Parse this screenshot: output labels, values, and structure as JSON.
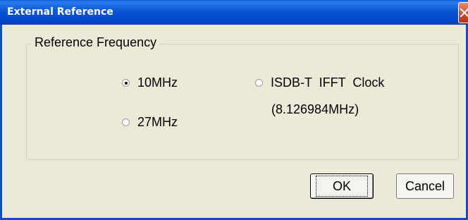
{
  "window": {
    "title": "External Reference"
  },
  "groupbox": {
    "label": "Reference Frequency"
  },
  "options": [
    {
      "label": "10MHz",
      "checked": true
    },
    {
      "label": "27MHz",
      "checked": false
    },
    {
      "label": "ISDB-T  IFFT  Clock",
      "sub_label": "(8.126984MHz)",
      "checked": false
    }
  ],
  "buttons": {
    "ok_label": "OK",
    "cancel_label": "Cancel"
  },
  "icons": {
    "close": "close-icon"
  }
}
